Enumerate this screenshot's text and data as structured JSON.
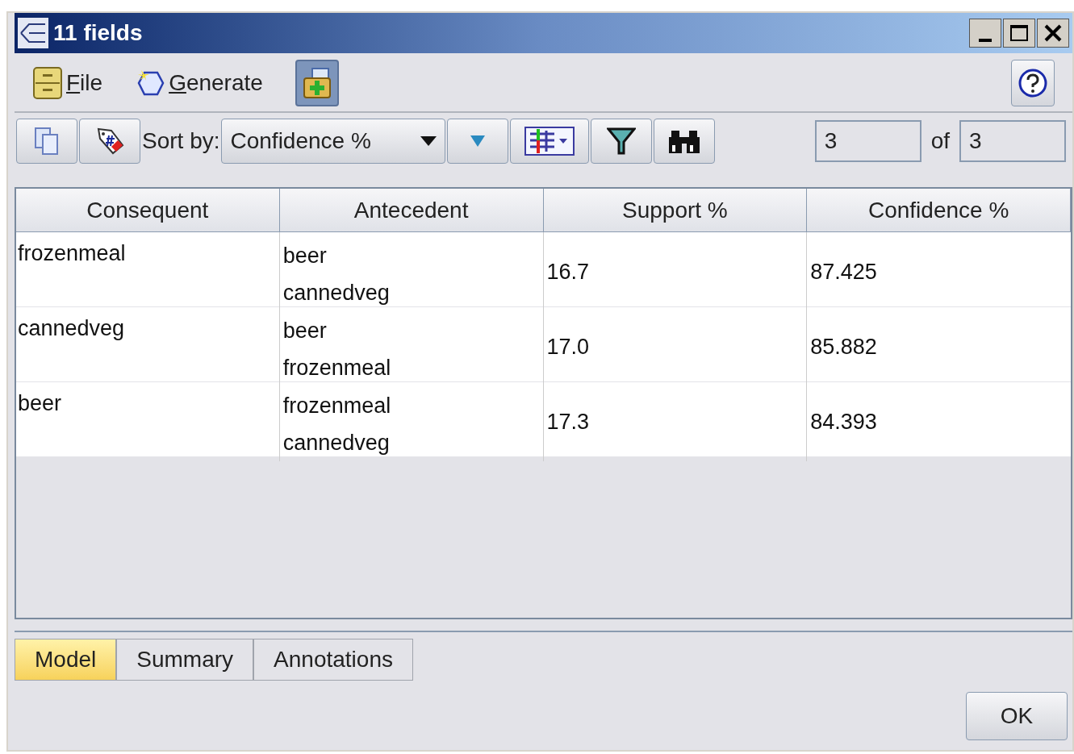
{
  "window": {
    "title": "11 fields"
  },
  "menu": [
    {
      "label": "File"
    },
    {
      "label": "Generate"
    }
  ],
  "toolbar": {
    "sort_label": "Sort by:",
    "sort_value": "Confidence %",
    "current": "3",
    "of_label": "of",
    "total": "3"
  },
  "table": {
    "columns": [
      "Consequent",
      "Antecedent",
      "Support %",
      "Confidence %"
    ],
    "rows": [
      {
        "consequent": "frozenmeal",
        "antecedent": [
          "beer",
          "cannedveg"
        ],
        "support": "16.7",
        "confidence": "87.425"
      },
      {
        "consequent": "cannedveg",
        "antecedent": [
          "beer",
          "frozenmeal"
        ],
        "support": "17.0",
        "confidence": "85.882"
      },
      {
        "consequent": "beer",
        "antecedent": [
          "frozenmeal",
          "cannedveg"
        ],
        "support": "17.3",
        "confidence": "84.393"
      }
    ]
  },
  "tabs": [
    {
      "label": "Model",
      "selected": true
    },
    {
      "label": "Summary",
      "selected": false
    },
    {
      "label": "Annotations",
      "selected": false
    }
  ],
  "buttons": [
    "OK"
  ]
}
